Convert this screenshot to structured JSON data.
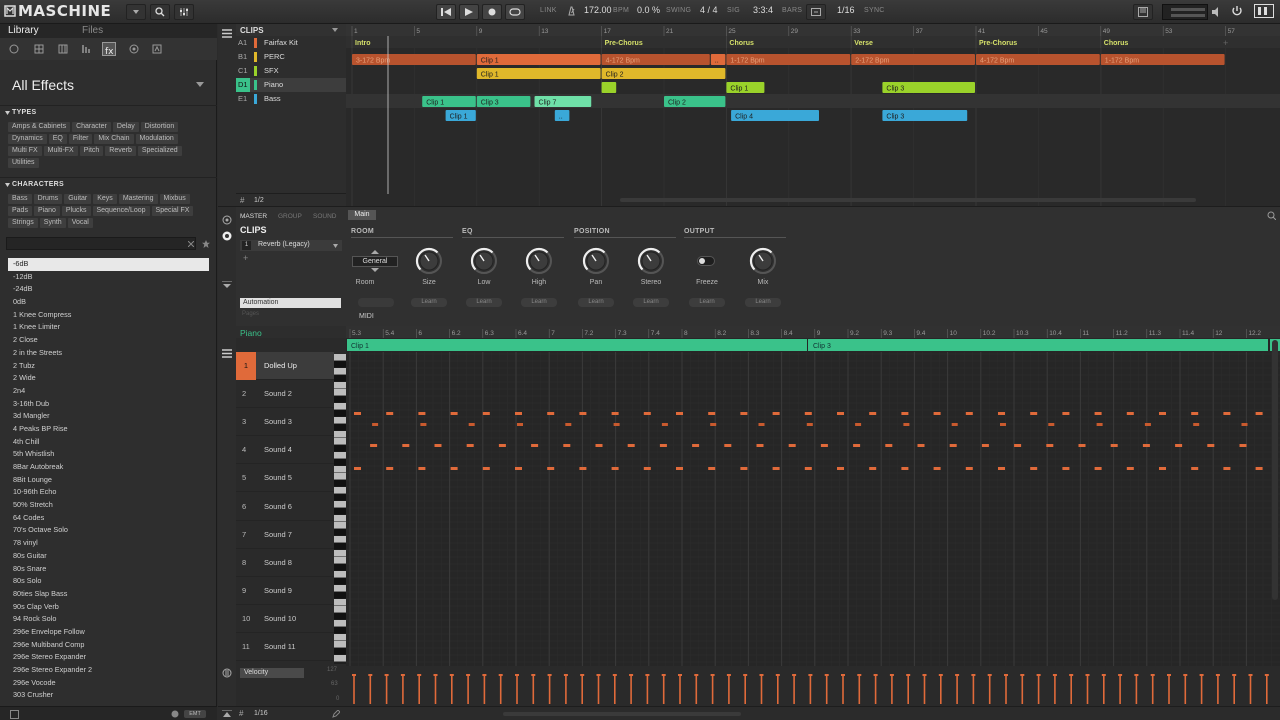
{
  "app": {
    "title": "MASCHINE"
  },
  "transport": {
    "link": "LINK",
    "bpm_value": "172.00",
    "bpm_unit": "BPM",
    "swing_value": "0.0 %",
    "swing_label": "SWING",
    "sig_value": "4 / 4",
    "sig_label": "SIG",
    "pos_value": "3:3:4",
    "pos_label": "BARS",
    "quant_value": "1/16",
    "sync_label": "SYNC"
  },
  "browser": {
    "tabs": [
      "Library",
      "Files"
    ],
    "category": "All Effects",
    "types_header": "TYPES",
    "types": [
      "Amps & Cabinets",
      "Character",
      "Delay",
      "Distortion",
      "Dynamics",
      "EQ",
      "Filter",
      "Mix Chain",
      "Modulation",
      "Multi FX",
      "Multi-FX",
      "Pitch",
      "Reverb",
      "Specialized",
      "Utilities"
    ],
    "characters_header": "CHARACTERS",
    "characters": [
      "Bass",
      "Drums",
      "Guitar",
      "Keys",
      "Mastering",
      "Mixbus",
      "Pads",
      "Piano",
      "Plucks",
      "Sequence/Loop",
      "Special FX",
      "Strings",
      "Synth",
      "Vocal"
    ],
    "results": [
      "-6dB",
      "-12dB",
      "-24dB",
      "0dB",
      "1 Knee Compress",
      "1 Knee Limiter",
      "2 Close",
      "2 in the Streets",
      "2 Tubz",
      "2 Wide",
      "2n4",
      "3-16th  Dub",
      "3d Mangler",
      "4 Peaks BP Rise",
      "4th Chill",
      "5th Whistlish",
      "8Bar Autobreak",
      "8Bit Lounge",
      "10-96th Echo",
      "50% Stretch",
      "64 Codes",
      "70's Octave Solo",
      "78 vinyl",
      "80s Guitar",
      "80s Snare",
      "80s Solo",
      "80ties Slap Bass",
      "90s Clap Verb",
      "94 Rock Solo",
      "296e Envelope Follow",
      "296e Multiband Comp",
      "296e Stereo Expander",
      "296e Stereo Expander 2",
      "296e Vocode",
      "303 Crusher"
    ],
    "footer_badge": "EMT"
  },
  "arranger": {
    "header_label": "CLIPS",
    "page": "1/2",
    "ruler": [
      "1",
      "5",
      "9",
      "13",
      "17",
      "21",
      "25",
      "29",
      "33",
      "37",
      "41",
      "45",
      "49",
      "53",
      "57"
    ],
    "scenes": [
      {
        "name": "Intro",
        "bar": 1
      },
      {
        "name": "Pre-Chorus",
        "bar": 17
      },
      {
        "name": "Chorus",
        "bar": 25
      },
      {
        "name": "Verse",
        "bar": 33
      },
      {
        "name": "Pre-Chorus",
        "bar": 41
      },
      {
        "name": "Chorus",
        "bar": 49
      }
    ],
    "tracks": [
      {
        "id": "A1",
        "name": "Fairfax Kit",
        "color": "#e06a3a"
      },
      {
        "id": "B1",
        "name": "PERC",
        "color": "#e0b82a"
      },
      {
        "id": "C1",
        "name": "SFX",
        "color": "#9ad22a"
      },
      {
        "id": "D1",
        "name": "Piano",
        "color": "#3ac28a"
      },
      {
        "id": "E1",
        "name": "Bass",
        "color": "#3aa8d8"
      }
    ],
    "clips": [
      {
        "row": 0,
        "start": 1,
        "end": 9,
        "label": "3-172 Bpm",
        "color": "#b8532e"
      },
      {
        "row": 0,
        "start": 9,
        "end": 17,
        "label": "Clip 1",
        "color": "#e06a3a"
      },
      {
        "row": 0,
        "start": 17,
        "end": 24,
        "label": "4-172 Bpm",
        "color": "#b8532e"
      },
      {
        "row": 0,
        "start": 24,
        "end": 25,
        "label": "..",
        "color": "#e06a3a"
      },
      {
        "row": 0,
        "start": 25,
        "end": 33,
        "label": "1-172 Bpm",
        "color": "#b8532e"
      },
      {
        "row": 0,
        "start": 33,
        "end": 41,
        "label": "2-172 Bpm",
        "color": "#b8532e"
      },
      {
        "row": 0,
        "start": 41,
        "end": 49,
        "label": "4-172 Bpm",
        "color": "#b8532e"
      },
      {
        "row": 0,
        "start": 49,
        "end": 57,
        "label": "1-172 Bpm",
        "color": "#b8532e"
      },
      {
        "row": 1,
        "start": 9,
        "end": 17,
        "label": "Clip 1",
        "color": "#e0b82a"
      },
      {
        "row": 1,
        "start": 17,
        "end": 25,
        "label": "Clip 2",
        "color": "#e0b82a"
      },
      {
        "row": 2,
        "start": 17,
        "end": 18,
        "label": "",
        "color": "#9ad22a"
      },
      {
        "row": 2,
        "start": 25,
        "end": 27.5,
        "label": "Clip 1",
        "color": "#9ad22a"
      },
      {
        "row": 2,
        "start": 35,
        "end": 41,
        "label": "Clip 3",
        "color": "#9ad22a"
      },
      {
        "row": 3,
        "start": 5.5,
        "end": 9,
        "label": "Clip 1",
        "color": "#3ac28a"
      },
      {
        "row": 3,
        "start": 9,
        "end": 12.5,
        "label": "Clip 3",
        "color": "#3ac28a"
      },
      {
        "row": 3,
        "start": 12.7,
        "end": 16.4,
        "label": "Clip 7",
        "color": "#6fe0a8"
      },
      {
        "row": 3,
        "start": 21,
        "end": 25,
        "label": "Clip 2",
        "color": "#3ac28a"
      },
      {
        "row": 4,
        "start": 7,
        "end": 9,
        "label": "Clip 1",
        "color": "#3aa8d8"
      },
      {
        "row": 4,
        "start": 14,
        "end": 15,
        "label": "..",
        "color": "#3aa8d8"
      },
      {
        "row": 4,
        "start": 25.3,
        "end": 31,
        "label": "Clip 4",
        "color": "#3aa8d8"
      },
      {
        "row": 4,
        "start": 35,
        "end": 40.5,
        "label": "Clip 3",
        "color": "#3aa8d8"
      }
    ]
  },
  "plugin": {
    "tabs": [
      "MASTER",
      "GROUP",
      "SOUND"
    ],
    "name": "CLIPS",
    "slot_num": "1",
    "slot_name": "Reverb (Legacy)",
    "page_tab": "Main",
    "automation": "Automation",
    "pages": "Pages",
    "midi": "MIDI",
    "groups": [
      "ROOM",
      "EQ",
      "POSITION",
      "OUTPUT"
    ],
    "room_value": "General",
    "controls": [
      "Room",
      "Size",
      "Low",
      "High",
      "Pan",
      "Stereo",
      "Freeze",
      "Mix"
    ],
    "learn": "Learn"
  },
  "pianoroll": {
    "group": "Piano",
    "ruler": [
      "5.3",
      "5.4",
      "6",
      "6.2",
      "6.3",
      "6.4",
      "7",
      "7.2",
      "7.3",
      "7.4",
      "8",
      "8.2",
      "8.3",
      "8.4",
      "9",
      "9.2",
      "9.3",
      "9.4",
      "10",
      "10.2",
      "10.3",
      "10.4",
      "11",
      "11.2",
      "11.3",
      "11.4",
      "12",
      "12.2"
    ],
    "clips": [
      {
        "label": "Clip 1"
      },
      {
        "label": "Clip 3"
      }
    ],
    "sounds": [
      "Dolled Up",
      "Sound 2",
      "Sound 3",
      "Sound 4",
      "Sound 5",
      "Sound 6",
      "Sound 7",
      "Sound 8",
      "Sound 9",
      "Sound 10",
      "Sound 11"
    ],
    "velocity_label": "Velocity",
    "vel_scale": [
      "127",
      "63",
      "0"
    ],
    "quant": "1/16"
  }
}
